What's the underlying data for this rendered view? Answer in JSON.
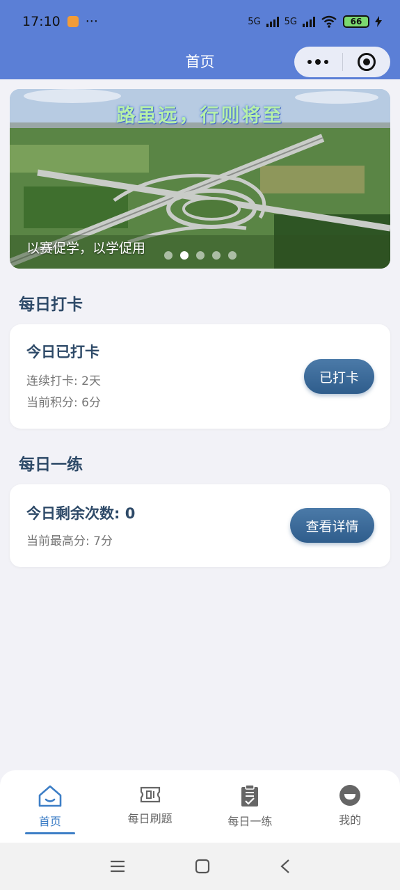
{
  "status_bar": {
    "time": "17:10",
    "more": "···",
    "network1": "5G",
    "network2": "5G",
    "battery": "66"
  },
  "nav": {
    "title": "首页"
  },
  "banner": {
    "slogan": "路虽远，行则将至",
    "caption": "以赛促学，以学促用",
    "active_dot": 1,
    "dot_count": 5
  },
  "checkin": {
    "section_title": "每日打卡",
    "status": "今日已打卡",
    "streak": "连续打卡: 2天",
    "points": "当前积分: 6分",
    "button": "已打卡"
  },
  "practice": {
    "section_title": "每日一练",
    "remaining": "今日剩余次数: 0",
    "best": "当前最高分: 7分",
    "button": "查看详情"
  },
  "tabs": [
    {
      "label": "首页",
      "icon": "home-icon",
      "active": true
    },
    {
      "label": "每日刷题",
      "icon": "ticket-icon",
      "active": false
    },
    {
      "label": "每日一练",
      "icon": "clipboard-check-icon",
      "active": false
    },
    {
      "label": "我的",
      "icon": "profile-icon",
      "active": false
    }
  ],
  "colors": {
    "header": "#5b7fd6",
    "accent": "#3d7ec6",
    "button": "#2f5d8c"
  }
}
